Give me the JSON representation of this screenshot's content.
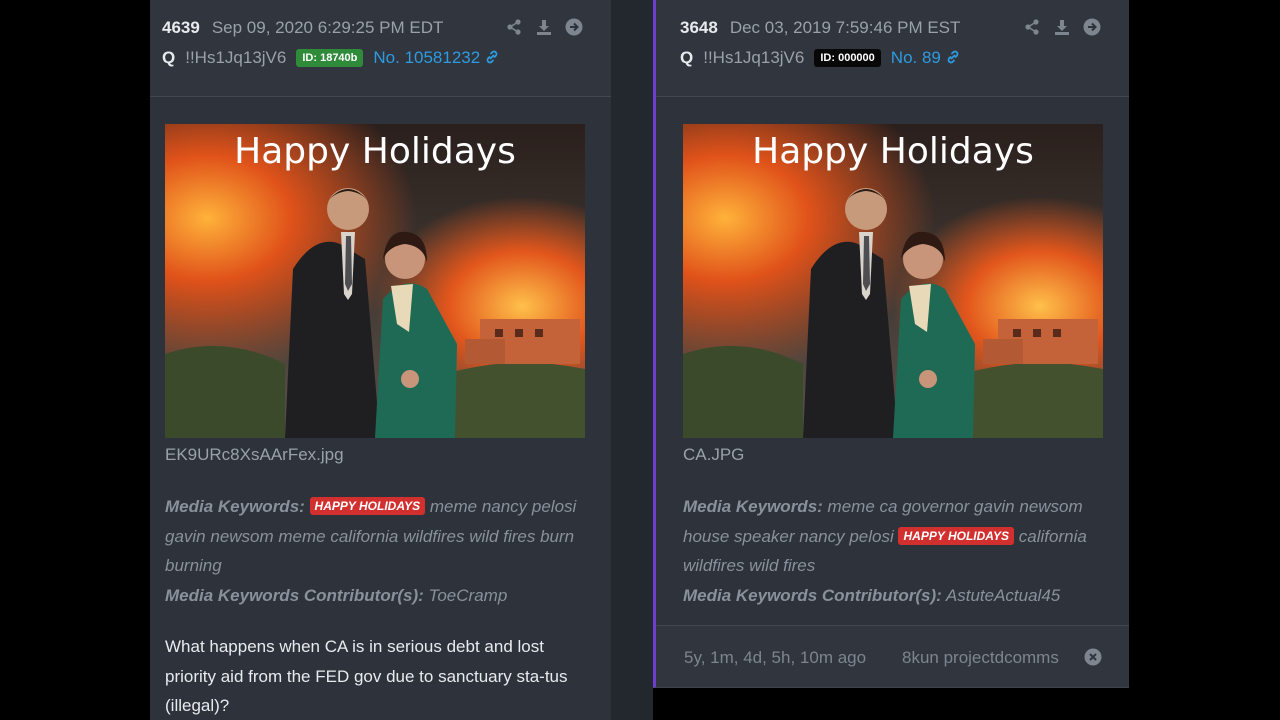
{
  "left": {
    "post_count": "4639",
    "date": "Sep 09, 2020 6:29:25 PM EDT",
    "author": "Q",
    "tripcode": "!!Hs1Jq13jV6",
    "id_badge": "ID: 18740b",
    "post_number": "No. 10581232",
    "image_title": "Happy Holidays",
    "filename": "EK9URc8XsAArFex.jpg",
    "kw_label": "Media Keywords:",
    "kw_badge": "HAPPY HOLIDAYS",
    "kw_text": "meme nancy pelosi gavin newsom meme california wildfires wild fires burn burning",
    "contrib_label": "Media Keywords Contributor(s):",
    "contrib_name": "ToeCramp",
    "body": "What happens when CA is in serious debt and lost priority aid from the FED gov due to sanctuary sta-tus (illegal)?"
  },
  "right": {
    "post_count": "3648",
    "date": "Dec 03, 2019 7:59:46 PM EST",
    "author": "Q",
    "tripcode": "!!Hs1Jq13jV6",
    "id_badge": "ID: 000000",
    "post_number": "No. 89",
    "image_title": "Happy Holidays",
    "filename": "CA.JPG",
    "kw_label": "Media Keywords:",
    "kw_text_1": "meme ca governor gavin newsom house speaker nancy pelosi",
    "kw_badge": "HAPPY HOLIDAYS",
    "kw_text_2": "california wildfires wild fires",
    "contrib_label": "Media Keywords Contributor(s):",
    "contrib_name": "AstuteActual45",
    "time_ago": "5y, 1m, 4d, 5h, 10m ago",
    "source": "8kun projectdcomms"
  },
  "colors": {
    "panel": "#2d323b",
    "accent_link": "#2e9be0",
    "badge_red": "#d2302f",
    "badge_green": "#2f8a3a",
    "border_purple": "#6d3fd0"
  },
  "icons": [
    "share-icon",
    "download-icon",
    "arrow-right-icon",
    "link-icon",
    "close-circle-icon"
  ]
}
